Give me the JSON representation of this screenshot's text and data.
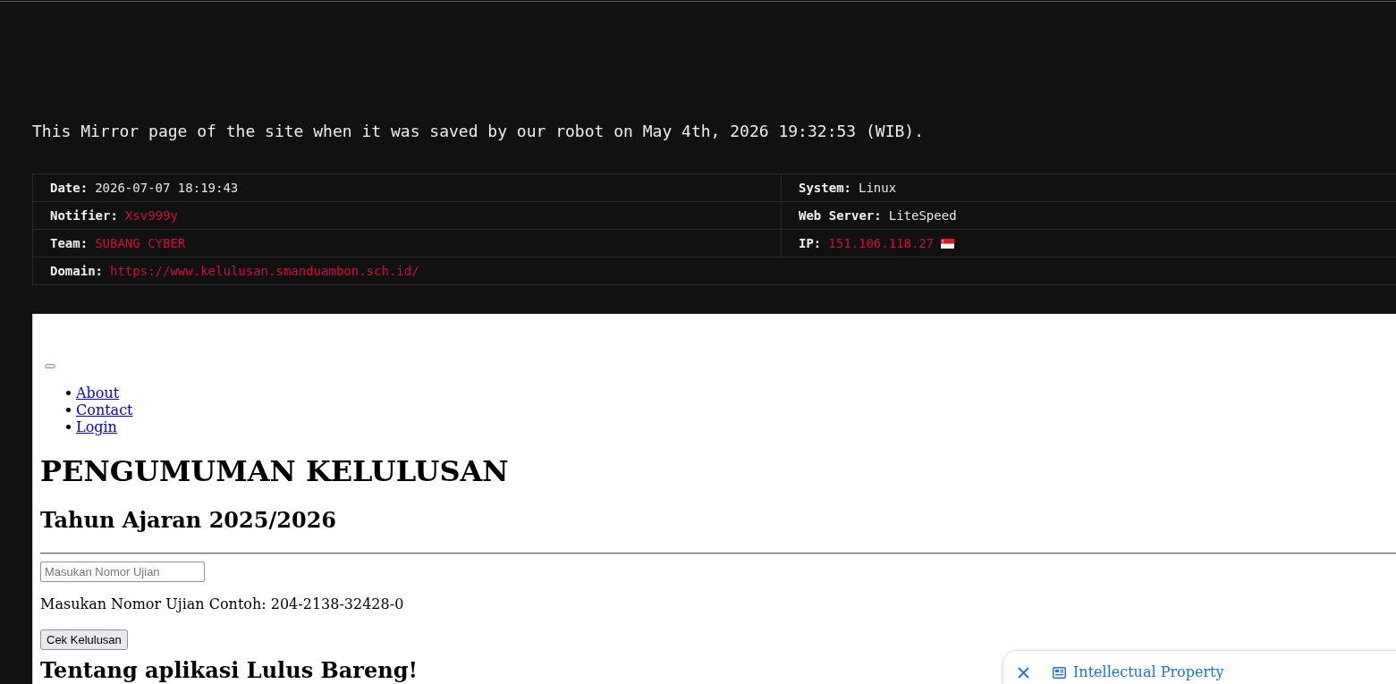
{
  "notice": "This Mirror page of the site when it was saved by our robot on May 4th, 2026 19:32:53 (WIB).",
  "info_table": {
    "rows": [
      {
        "cells": [
          {
            "label": "Date:",
            "value": "2026-07-07 18:19:43",
            "link": false,
            "flag": false
          },
          {
            "label": "System:",
            "value": "Linux",
            "link": false,
            "flag": false
          }
        ]
      },
      {
        "cells": [
          {
            "label": "Notifier:",
            "value": "Xsv999y",
            "link": true,
            "flag": false
          },
          {
            "label": "Web Server:",
            "value": "LiteSpeed",
            "link": false,
            "flag": false
          }
        ]
      },
      {
        "cells": [
          {
            "label": "Team:",
            "value": "SUBANG CYBER",
            "link": true,
            "flag": false
          },
          {
            "label": "IP:",
            "value": "151.106.118.27",
            "link": true,
            "flag": true
          }
        ]
      },
      {
        "cells": [
          {
            "label": "Domain:",
            "value": "https://www.kelulusan.smanduambon.sch.id/",
            "link": true,
            "flag": false,
            "colspan": 2
          }
        ]
      }
    ]
  },
  "mirror_page": {
    "menu_toggle": true,
    "nav_links": [
      {
        "label": "About"
      },
      {
        "label": "Contact"
      },
      {
        "label": "Login"
      }
    ],
    "title": "PENGUMUMAN KELULUSAN",
    "subtitle": "Tahun Ajaran 2025/2026",
    "exam_field": {
      "placeholder": "Masukan Nomor Ujian"
    },
    "hint": "Masukan Nomor Ujian Contoh: 204-2138-32428-0",
    "submit_button": "Cek Kelulusan",
    "section_heading": "Tentang aplikasi Lulus Bareng!"
  },
  "popup": {
    "label": "Intellectual Property"
  }
}
